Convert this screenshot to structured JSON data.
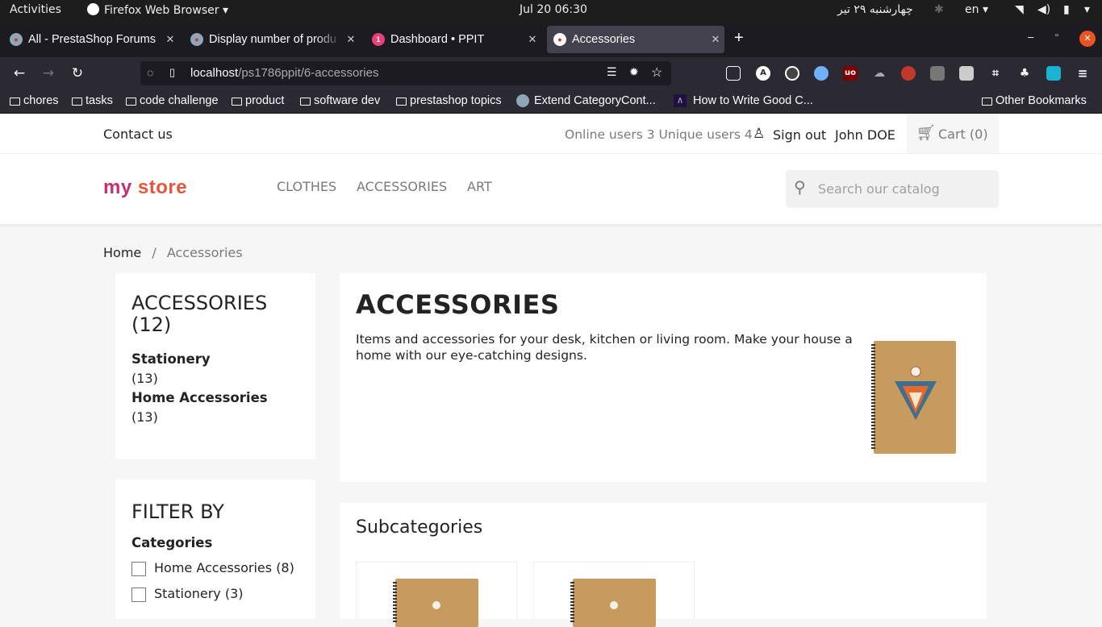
{
  "system": {
    "activities": "Activities",
    "app": "Firefox Web Browser",
    "clock": "Jul 20  06:30",
    "persian_date": "چهارشنبه ۲۹ تیر",
    "lang": "en"
  },
  "tabs": [
    {
      "label": "All - PrestaShop Forums"
    },
    {
      "label": "Display number of produ"
    },
    {
      "label": "Dashboard • PPIT"
    },
    {
      "label": "Accessories"
    }
  ],
  "address": {
    "host": "localhost",
    "path": "/ps1786ppit/6-accessories"
  },
  "bookmarks": [
    {
      "label": "chores"
    },
    {
      "label": "tasks"
    },
    {
      "label": "code challenge"
    },
    {
      "label": "product"
    },
    {
      "label": "software dev"
    },
    {
      "label": "prestashop topics"
    },
    {
      "label": "Extend CategoryCont..."
    },
    {
      "label": "How to Write Good C..."
    }
  ],
  "other_bookmarks": "Other Bookmarks",
  "site": {
    "contact": "Contact us",
    "online": "Online users 3 Unique users 4",
    "sign_out": "Sign out",
    "user": "John DOE",
    "cart": "Cart (0)",
    "logo_word1": "my",
    "logo_word2": "store",
    "menu": [
      "CLOTHES",
      "ACCESSORIES",
      "ART"
    ],
    "search_placeholder": "Search our catalog",
    "breadcrumb_home": "Home",
    "breadcrumb_sep": "/",
    "breadcrumb_current": "Accessories"
  },
  "sidebar": {
    "title": "ACCESSORIES",
    "count": "(12)",
    "subcats": [
      {
        "name": "Stationery",
        "count": "(13)"
      },
      {
        "name": "Home Accessories",
        "count": "(13)"
      }
    ],
    "filter_title": "FILTER BY",
    "filter_group": "Categories",
    "filters": [
      {
        "label": "Home Accessories (8)"
      },
      {
        "label": "Stationery (3)"
      }
    ]
  },
  "category": {
    "title": "ACCESSORIES",
    "description": "Items and accessories for your desk, kitchen or living room. Make your house a home with our eye-catching designs.",
    "subcategories_title": "Subcategories"
  },
  "colors": {
    "accent": "#24b9d7",
    "browser_dark": "#1c1b22"
  }
}
